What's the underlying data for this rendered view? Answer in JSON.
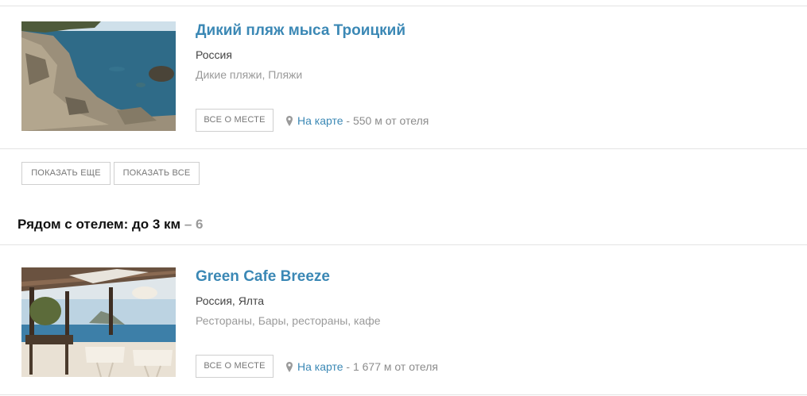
{
  "places": [
    {
      "title": "Дикий пляж мыса Троицкий",
      "location": "Россия",
      "categories": "Дикие пляжи, Пляжи",
      "about_label": "ВСЕ О МЕСТЕ",
      "map_label": "На карте",
      "distance": " - 550 м от отеля"
    },
    {
      "title": "Green Cafe Breeze",
      "location": "Россия, Ялта",
      "categories": "Рестораны, Бары, рестораны, кафе",
      "about_label": "ВСЕ О МЕСТЕ",
      "map_label": "На карте",
      "distance": " - 1 677 м от отеля"
    }
  ],
  "pagination": {
    "show_more": "ПОКАЗАТЬ ЕЩЕ",
    "show_all": "ПОКАЗАТЬ ВСЕ"
  },
  "section": {
    "title": "Рядом с отелем: до 3 км",
    "separator": " – ",
    "count": "6"
  },
  "icons": {
    "map": "map-pin-icon"
  },
  "colors": {
    "link": "#3b88b5",
    "muted": "#9a9a9a",
    "border": "#cfcfcf"
  }
}
